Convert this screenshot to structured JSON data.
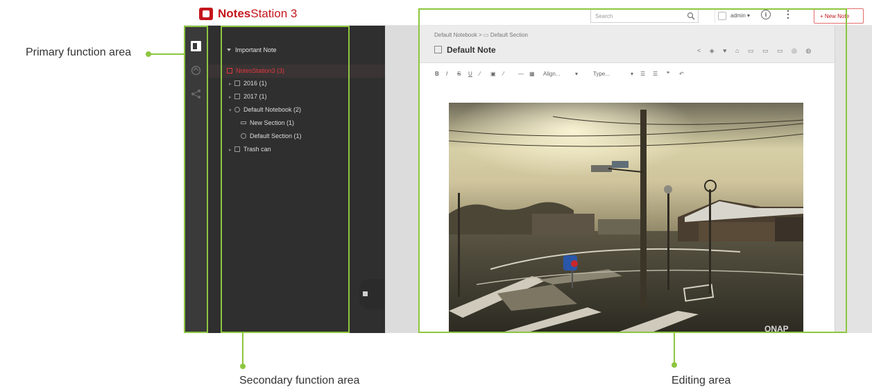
{
  "app": {
    "title_bold": "Notes",
    "title_rest": "Station 3",
    "search_placeholder": "Search",
    "user_name": "admin ▾",
    "info_glyph": "i",
    "more_glyph": "⋮",
    "new_note_label": "+ New Note"
  },
  "secondary": {
    "tab_label": "Important Note",
    "tree": [
      {
        "label": "NotesStation3 (3)",
        "level": 0,
        "icon": "notebook-root-icon"
      },
      {
        "label": "2016 (1)",
        "level": 1,
        "icon": "folder-icon"
      },
      {
        "label": "2017 (1)",
        "level": 1,
        "icon": "folder-icon"
      },
      {
        "label": "Default Notebook (2)",
        "level": 1,
        "icon": "notebook-icon"
      },
      {
        "label": "New Section (1)",
        "level": 2,
        "icon": "section-icon"
      },
      {
        "label": "Default Section (1)",
        "level": 2,
        "icon": "section-icon"
      },
      {
        "label": "Trash can",
        "level": 1,
        "icon": "trash-icon"
      }
    ]
  },
  "editor": {
    "breadcrumb": "Default Notebook  >  ▭ Default Section",
    "note_title": "Default Note",
    "head_icons": "< ◈ ♥ ⌂ ▭ ▭ ▭ ◎ ◍",
    "toolbar": {
      "bold": "B",
      "italic": "I",
      "strike": "S",
      "underline": "U",
      "align": "Align...",
      "type": "Type...",
      "quote": "❞"
    },
    "watermark": "QNAP"
  },
  "annotations": {
    "primary": "Primary function area",
    "secondary": "Secondary function area",
    "editing": "Editing area"
  },
  "colors": {
    "accent_green": "#8dc63f",
    "brand_red": "#c4161c"
  }
}
